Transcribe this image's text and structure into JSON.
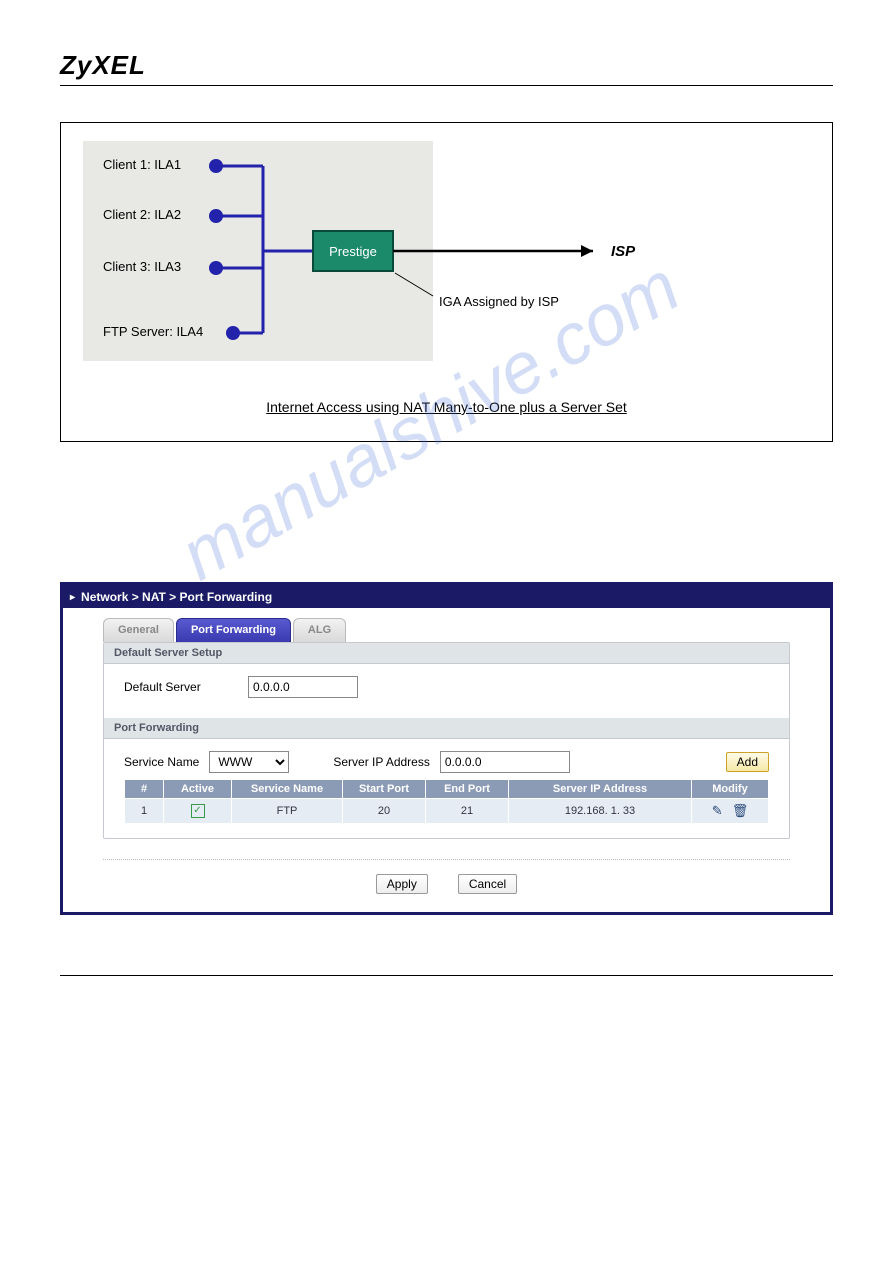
{
  "brand": "ZyXEL",
  "watermark": "manualshive.com",
  "diagram": {
    "clients": [
      "Client 1: ILA1",
      "Client 2: ILA2",
      "Client 3: ILA3",
      "FTP Server: ILA4"
    ],
    "router_label": "Prestige",
    "isp_label": "ISP",
    "iga_label": "IGA Assigned by ISP",
    "caption": "Internet Access using NAT Many-to-One plus a Server Set"
  },
  "breadcrumb": "Network > NAT > Port Forwarding",
  "tabs": {
    "general": "General",
    "port_forwarding": "Port Forwarding",
    "alg": "ALG"
  },
  "default_server": {
    "section_title": "Default Server Setup",
    "label": "Default Server",
    "value": "0.0.0.0"
  },
  "port_forwarding": {
    "section_title": "Port Forwarding",
    "service_name_label": "Service Name",
    "service_name_value": "WWW",
    "server_ip_label": "Server IP Address",
    "server_ip_value": "0.0.0.0",
    "add_label": "Add",
    "columns": {
      "num": "#",
      "active": "Active",
      "service": "Service Name",
      "start": "Start Port",
      "end": "End Port",
      "ip": "Server IP Address",
      "modify": "Modify"
    },
    "rows": [
      {
        "num": "1",
        "active": true,
        "service": "FTP",
        "start": "20",
        "end": "21",
        "ip": "192.168. 1. 33"
      }
    ]
  },
  "buttons": {
    "apply": "Apply",
    "cancel": "Cancel"
  }
}
